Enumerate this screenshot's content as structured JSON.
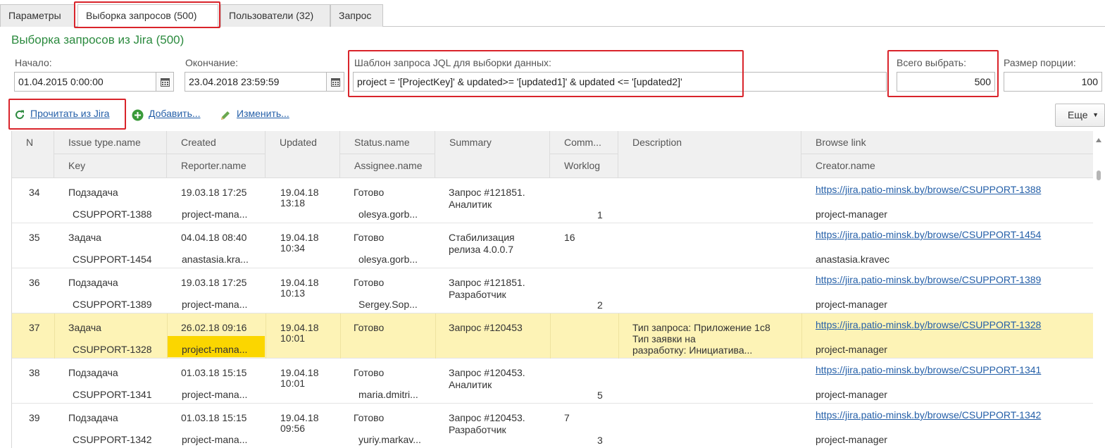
{
  "tabs": [
    {
      "label": "Параметры"
    },
    {
      "label": "Выборка запросов (500)"
    },
    {
      "label": "Пользователи (32)"
    },
    {
      "label": "Запрос"
    }
  ],
  "title": "Выборка запросов из Jira (500)",
  "form": {
    "start_label": "Начало:",
    "start_value": "01.04.2015  0:00:00",
    "end_label": "Окончание:",
    "end_value": "23.04.2018 23:59:59",
    "jql_label": "Шаблон запроса JQL для выборки данных:",
    "jql_value": "project = '[ProjectKey]' & updated>= '[updated1]' & updated <= '[updated2]'",
    "total_label": "Всего выбрать:",
    "total_value": "500",
    "portion_label": "Размер порции:",
    "portion_value": "100"
  },
  "toolbar": {
    "read_label": "Прочитать из Jira",
    "add_label": "Добавить...",
    "edit_label": "Изменить...",
    "more_label": "Еще"
  },
  "colors": {
    "accent": "#2b8a3e",
    "link": "#245fa8",
    "highlight": "#d9242b",
    "selected_row": "#fdf3b6",
    "selected_cell": "#fbd600"
  },
  "table": {
    "headers": {
      "n": "N",
      "issue_type": "Issue type.name",
      "key": "Key",
      "created": "Created",
      "reporter": "Reporter.name",
      "updated": "Updated",
      "status": "Status.name",
      "assignee": "Assignee.name",
      "summary": "Summary",
      "comm": "Comm...",
      "worklog": "Worklog",
      "description": "Description",
      "browse": "Browse link",
      "creator": "Creator.name"
    },
    "rows": [
      {
        "n": "34",
        "type": "Подзадача",
        "key": "CSUPPORT-1388",
        "created": "19.03.18 17:25",
        "reporter": "project-mana...",
        "updated1": "19.04.18",
        "updated2": "13:18",
        "status": "Готово",
        "assignee": "olesya.gorb...",
        "summary1": "Запрос #121851.",
        "summary2": "Аналитик",
        "comm": "",
        "worklog": "1",
        "desc1": "",
        "desc2": "",
        "desc3": "",
        "link": "https://jira.patio-minsk.by/browse/CSUPPORT-1388",
        "creator": "project-manager"
      },
      {
        "n": "35",
        "type": "Задача",
        "key": "CSUPPORT-1454",
        "created": "04.04.18 08:40",
        "reporter": "anastasia.kra...",
        "updated1": "19.04.18",
        "updated2": "10:34",
        "status": "Готово",
        "assignee": "olesya.gorb...",
        "summary1": "Стабилизация",
        "summary2": "релиза 4.0.0.7",
        "comm": "16",
        "worklog": "",
        "desc1": "",
        "desc2": "",
        "desc3": "",
        "link": "https://jira.patio-minsk.by/browse/CSUPPORT-1454",
        "creator": "anastasia.kravec"
      },
      {
        "n": "36",
        "type": "Подзадача",
        "key": "CSUPPORT-1389",
        "created": "19.03.18 17:25",
        "reporter": "project-mana...",
        "updated1": "19.04.18",
        "updated2": "10:13",
        "status": "Готово",
        "assignee": "Sergey.Sop...",
        "summary1": "Запрос #121851.",
        "summary2": "Разработчик",
        "comm": "",
        "worklog": "2",
        "desc1": "",
        "desc2": "",
        "desc3": "",
        "link": "https://jira.patio-minsk.by/browse/CSUPPORT-1389",
        "creator": "project-manager"
      },
      {
        "n": "37",
        "type": "Задача",
        "key": "CSUPPORT-1328",
        "created": "26.02.18 09:16",
        "reporter": "project-mana...",
        "updated1": "19.04.18",
        "updated2": "10:01",
        "status": "Готово",
        "assignee": "",
        "summary1": "Запрос #120453",
        "summary2": "",
        "comm": "",
        "worklog": "",
        "desc1": "Тип запроса:   Приложение 1с8",
        "desc2": "Тип заявки на",
        "desc3": "разработку: Инициатива...",
        "link": "https://jira.patio-minsk.by/browse/CSUPPORT-1328",
        "creator": "project-manager"
      },
      {
        "n": "38",
        "type": "Подзадача",
        "key": "CSUPPORT-1341",
        "created": "01.03.18 15:15",
        "reporter": "project-mana...",
        "updated1": "19.04.18",
        "updated2": "10:01",
        "status": "Готово",
        "assignee": "maria.dmitri...",
        "summary1": "Запрос #120453.",
        "summary2": "Аналитик",
        "comm": "",
        "worklog": "5",
        "desc1": "",
        "desc2": "",
        "desc3": "",
        "link": "https://jira.patio-minsk.by/browse/CSUPPORT-1341",
        "creator": "project-manager"
      },
      {
        "n": "39",
        "type": "Подзадача",
        "key": "CSUPPORT-1342",
        "created": "01.03.18 15:15",
        "reporter": "project-mana...",
        "updated1": "19.04.18",
        "updated2": "09:56",
        "status": "Готово",
        "assignee": "yuriy.markav...",
        "summary1": "Запрос #120453.",
        "summary2": "Разработчик",
        "comm": "7",
        "worklog": "3",
        "desc1": "",
        "desc2": "",
        "desc3": "",
        "link": "https://jira.patio-minsk.by/browse/CSUPPORT-1342",
        "creator": "project-manager"
      }
    ]
  }
}
